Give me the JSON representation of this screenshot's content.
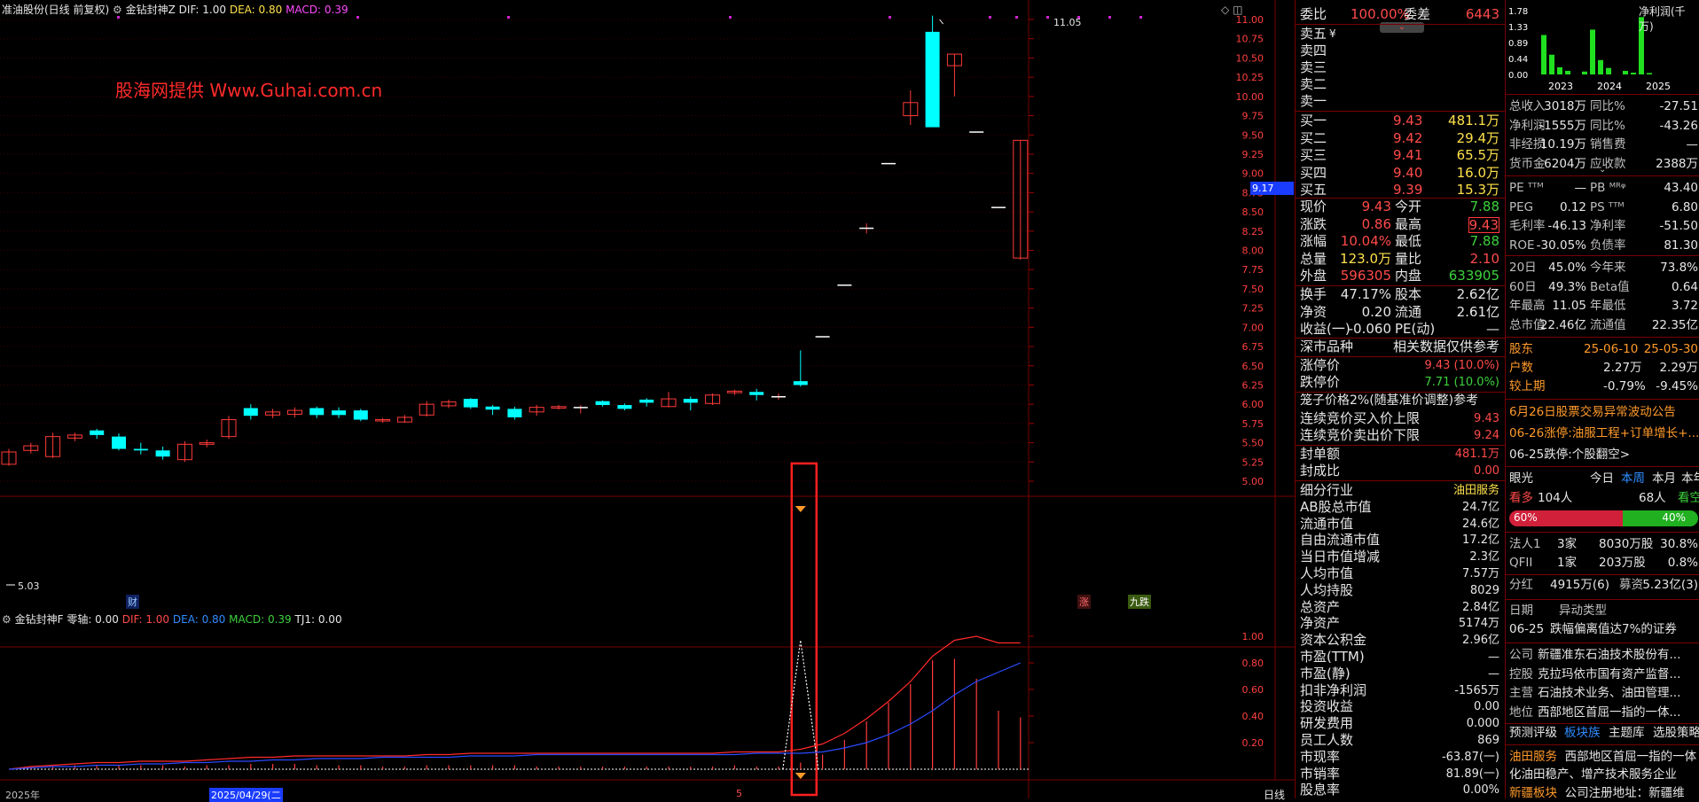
{
  "chart_header": {
    "stock_name": "准油股份(日线 前复权)",
    "indicator": "金钻封神Z",
    "dif": "DIF: 1.00",
    "dea": "DEA: 0.80",
    "macd": "MACD: 0.39"
  },
  "watermark": "股海网提供  Www.Guhai.com.cn",
  "price_axis": [
    "11.00",
    "10.75",
    "10.50",
    "10.25",
    "10.00",
    "9.75",
    "9.50",
    "9.25",
    "9.00",
    "8.75",
    "8.50",
    "8.25",
    "8.00",
    "7.75",
    "7.50",
    "7.25",
    "7.00",
    "6.75",
    "6.50",
    "6.25",
    "6.00",
    "5.75",
    "5.50",
    "5.25",
    "5.00"
  ],
  "price_tag": "9.17",
  "high_label": "11.05",
  "low_label": "5.03",
  "event_markers": {
    "cai": "财",
    "zhang": "涨",
    "jiudie": "九跌"
  },
  "sub_header": {
    "indicator": "金钻封神F",
    "zero": "零轴: 0.00",
    "dif": "DIF: 1.00",
    "dea": "DEA: 0.80",
    "macd": "MACD: 0.39",
    "tj1": "TJ1: 0.00"
  },
  "sub_axis": [
    "1.00",
    "0.80",
    "0.60",
    "0.40",
    "0.20"
  ],
  "date_axis": {
    "year": "2025年",
    "date": "2025/04/29(二",
    "mark": "5",
    "period": "日线"
  },
  "chart_data": {
    "type": "candlestick",
    "title": "准油股份(日线 前复权)",
    "ylim": [
      4.9,
      11.15
    ],
    "candles": [
      {
        "o": 5.22,
        "c": 5.38,
        "h": 5.42,
        "l": 5.2
      },
      {
        "o": 5.4,
        "c": 5.46,
        "h": 5.5,
        "l": 5.36
      },
      {
        "o": 5.32,
        "c": 5.58,
        "h": 5.63,
        "l": 5.3
      },
      {
        "o": 5.56,
        "c": 5.6,
        "h": 5.63,
        "l": 5.52
      },
      {
        "o": 5.66,
        "c": 5.6,
        "h": 5.68,
        "l": 5.55
      },
      {
        "o": 5.58,
        "c": 5.42,
        "h": 5.62,
        "l": 5.4
      },
      {
        "o": 5.42,
        "c": 5.4,
        "h": 5.5,
        "l": 5.35
      },
      {
        "o": 5.4,
        "c": 5.32,
        "h": 5.45,
        "l": 5.28
      },
      {
        "o": 5.28,
        "c": 5.48,
        "h": 5.52,
        "l": 5.25
      },
      {
        "o": 5.48,
        "c": 5.5,
        "h": 5.54,
        "l": 5.44
      },
      {
        "o": 5.58,
        "c": 5.8,
        "h": 5.85,
        "l": 5.55
      },
      {
        "o": 5.95,
        "c": 5.85,
        "h": 6.0,
        "l": 5.8
      },
      {
        "o": 5.86,
        "c": 5.9,
        "h": 5.94,
        "l": 5.82
      },
      {
        "o": 5.87,
        "c": 5.92,
        "h": 5.96,
        "l": 5.83
      },
      {
        "o": 5.95,
        "c": 5.86,
        "h": 5.97,
        "l": 5.82
      },
      {
        "o": 5.92,
        "c": 5.86,
        "h": 5.96,
        "l": 5.82
      },
      {
        "o": 5.92,
        "c": 5.8,
        "h": 5.94,
        "l": 5.78
      },
      {
        "o": 5.79,
        "c": 5.8,
        "h": 5.82,
        "l": 5.76
      },
      {
        "o": 5.77,
        "c": 5.83,
        "h": 5.86,
        "l": 5.76
      },
      {
        "o": 5.86,
        "c": 6.0,
        "h": 6.04,
        "l": 5.84
      },
      {
        "o": 5.98,
        "c": 6.03,
        "h": 6.06,
        "l": 5.95
      },
      {
        "o": 6.07,
        "c": 5.96,
        "h": 6.08,
        "l": 5.94
      },
      {
        "o": 5.97,
        "c": 5.93,
        "h": 5.99,
        "l": 5.86
      },
      {
        "o": 5.94,
        "c": 5.83,
        "h": 5.97,
        "l": 5.8
      },
      {
        "o": 5.9,
        "c": 5.96,
        "h": 5.99,
        "l": 5.85
      },
      {
        "o": 5.95,
        "c": 5.97,
        "h": 5.99,
        "l": 5.93
      },
      {
        "o": 5.96,
        "c": 5.96,
        "h": 5.99,
        "l": 5.88
      },
      {
        "o": 6.04,
        "c": 5.99,
        "h": 6.05,
        "l": 5.97
      },
      {
        "o": 5.99,
        "c": 5.94,
        "h": 6.01,
        "l": 5.92
      },
      {
        "o": 6.06,
        "c": 6.02,
        "h": 6.08,
        "l": 5.97
      },
      {
        "o": 5.97,
        "c": 6.07,
        "h": 6.16,
        "l": 5.96
      },
      {
        "o": 6.07,
        "c": 6.02,
        "h": 6.1,
        "l": 5.92
      },
      {
        "o": 6.01,
        "c": 6.12,
        "h": 6.14,
        "l": 5.99
      },
      {
        "o": 6.15,
        "c": 6.17,
        "h": 6.19,
        "l": 6.12
      },
      {
        "o": 6.16,
        "c": 6.12,
        "h": 6.2,
        "l": 6.05
      },
      {
        "o": 6.1,
        "c": 6.1,
        "h": 6.14,
        "l": 6.06
      },
      {
        "o": 6.3,
        "c": 6.25,
        "h": 6.7,
        "l": 6.23
      },
      {
        "o": 6.88,
        "c": 6.88,
        "h": 6.88,
        "l": 6.88
      },
      {
        "o": 7.55,
        "c": 7.55,
        "h": 7.55,
        "l": 7.55
      },
      {
        "o": 8.29,
        "c": 8.29,
        "h": 8.35,
        "l": 8.22
      },
      {
        "o": 9.13,
        "c": 9.13,
        "h": 9.13,
        "l": 9.13
      },
      {
        "o": 9.75,
        "c": 9.92,
        "h": 10.08,
        "l": 9.63
      },
      {
        "o": 10.84,
        "c": 9.6,
        "h": 11.05,
        "l": 9.6
      },
      {
        "o": 10.4,
        "c": 10.55,
        "h": 10.55,
        "l": 10.0
      },
      {
        "o": 9.54,
        "c": 9.54,
        "h": 9.54,
        "l": 9.54
      },
      {
        "o": 8.56,
        "c": 8.56,
        "h": 8.56,
        "l": 8.56
      },
      {
        "o": 7.9,
        "c": 9.43,
        "h": 9.43,
        "l": 7.88
      }
    ],
    "sub_series": [
      {
        "name": "DIF",
        "values": [
          0.0,
          0.02,
          0.03,
          0.04,
          0.05,
          0.05,
          0.06,
          0.06,
          0.06,
          0.07,
          0.08,
          0.09,
          0.09,
          0.1,
          0.1,
          0.1,
          0.1,
          0.1,
          0.1,
          0.11,
          0.11,
          0.12,
          0.12,
          0.12,
          0.12,
          0.12,
          0.12,
          0.12,
          0.12,
          0.12,
          0.12,
          0.12,
          0.12,
          0.13,
          0.13,
          0.13,
          0.15,
          0.19,
          0.27,
          0.38,
          0.51,
          0.66,
          0.85,
          0.97,
          1.0,
          0.95,
          0.95
        ]
      },
      {
        "name": "DEA",
        "values": [
          0.0,
          0.01,
          0.02,
          0.02,
          0.03,
          0.03,
          0.04,
          0.04,
          0.05,
          0.05,
          0.06,
          0.06,
          0.07,
          0.07,
          0.08,
          0.08,
          0.08,
          0.09,
          0.09,
          0.09,
          0.09,
          0.1,
          0.1,
          0.1,
          0.11,
          0.11,
          0.11,
          0.11,
          0.11,
          0.11,
          0.11,
          0.11,
          0.11,
          0.11,
          0.12,
          0.12,
          0.12,
          0.13,
          0.16,
          0.2,
          0.26,
          0.34,
          0.44,
          0.56,
          0.66,
          0.73,
          0.8
        ]
      },
      {
        "name": "MACD",
        "values": [
          0,
          0.02,
          0.02,
          0.03,
          0.03,
          0.03,
          0.03,
          0.03,
          0.02,
          0.03,
          0.03,
          0.04,
          0.04,
          0.04,
          0.03,
          0.03,
          0.03,
          0.02,
          0.02,
          0.03,
          0.03,
          0.03,
          0.03,
          0.03,
          0.02,
          0.02,
          0.02,
          0.02,
          0.02,
          0.02,
          0.02,
          0.02,
          0.02,
          0.03,
          0.02,
          0.02,
          0.05,
          0.11,
          0.22,
          0.36,
          0.5,
          0.64,
          0.82,
          0.83,
          0.68,
          0.44,
          0.39
        ]
      }
    ]
  },
  "quote": {
    "weibi_label": "委比",
    "weibi_value": "100.00%",
    "weicha_label": "委差",
    "weicha_value": "6443",
    "sell": [
      {
        "label": "卖五",
        "mark": "¥"
      },
      {
        "label": "卖四"
      },
      {
        "label": "卖三"
      },
      {
        "label": "卖二"
      },
      {
        "label": "卖一"
      }
    ],
    "buy": [
      {
        "label": "买一",
        "price": "9.43",
        "vol": "481.1万"
      },
      {
        "label": "买二",
        "price": "9.42",
        "vol": "29.4万"
      },
      {
        "label": "买三",
        "price": "9.41",
        "vol": "65.5万"
      },
      {
        "label": "买四",
        "price": "9.40",
        "vol": "16.0万"
      },
      {
        "label": "买五",
        "price": "9.39",
        "vol": "15.3万"
      }
    ],
    "stats": [
      {
        "l1": "现价",
        "v1": "9.43",
        "l2": "今开",
        "v2": "7.88"
      },
      {
        "l1": "涨跌",
        "v1": "0.86",
        "l2": "最高",
        "v2": "9.43"
      },
      {
        "l1": "涨幅",
        "v1": "10.04%",
        "l2": "最低",
        "v2": "7.88"
      },
      {
        "l1": "总量",
        "v1": "123.0万",
        "l2": "量比",
        "v2": "2.10"
      },
      {
        "l1": "外盘",
        "v1": "596305",
        "l2": "内盘",
        "v2": "633905"
      }
    ],
    "stats2": [
      {
        "l1": "换手",
        "v1": "47.17%",
        "l2": "股本",
        "v2": "2.62亿"
      },
      {
        "l1": "净资",
        "v1": "0.20",
        "l2": "流通",
        "v2": "2.61亿"
      },
      {
        "l1": "收益(一)",
        "v1": "-0.060",
        "l2": "PE(动)",
        "v2": "—"
      }
    ],
    "market": "深市品种",
    "market_note": "相关数据仅供参考",
    "limit_up_label": "涨停价",
    "limit_up": "9.43 (10.0%)",
    "limit_down_label": "跌停价",
    "limit_down": "7.71 (10.0%)",
    "cage_note": "笼子价格2%(随基准价调整)参考",
    "cage_buy_label": "连续竞价买入价上限",
    "cage_buy": "9.43",
    "cage_sell_label": "连续竞价卖出价下限",
    "cage_sell": "9.24",
    "seal_label": "封单额",
    "seal": "481.1万",
    "seal_ratio_label": "封成比",
    "seal_ratio": "0.00",
    "fund": [
      {
        "l": "细分行业",
        "v": "油田服务"
      },
      {
        "l": "AB股总市值",
        "v": "24.7亿"
      },
      {
        "l": "流通市值",
        "v": "24.6亿"
      },
      {
        "l": "自由流通市值",
        "v": "17.2亿"
      },
      {
        "l": "当日市值增减",
        "v": "2.3亿"
      },
      {
        "l": "人均市值",
        "v": "7.57万"
      },
      {
        "l": "人均持股",
        "v": "8029"
      },
      {
        "l": "总资产",
        "v": "2.84亿"
      },
      {
        "l": "净资产",
        "v": "5174万"
      },
      {
        "l": "资本公积金",
        "v": "2.96亿"
      },
      {
        "l": "市盈(TTM)",
        "v": "—"
      },
      {
        "l": "市盈(静)",
        "v": "—"
      },
      {
        "l": "扣非净利润",
        "v": "-1565万"
      },
      {
        "l": "投资收益",
        "v": "0.00"
      },
      {
        "l": "研发费用",
        "v": "0.000"
      },
      {
        "l": "员工人数",
        "v": "869"
      },
      {
        "l": "市现率",
        "v": "-63.87(一)"
      },
      {
        "l": "市销率",
        "v": "81.89(一)"
      },
      {
        "l": "股息率",
        "v": "0.00%"
      }
    ]
  },
  "finance": {
    "mini_chart": {
      "title": "净利润(千万)",
      "yticks": [
        "1.78",
        "1.33",
        "0.89",
        "0.44",
        "0.00"
      ],
      "years": [
        "2023",
        "2024",
        "2025"
      ],
      "values": [
        1.1,
        0.55,
        0.2,
        0.1,
        0.08,
        1.25,
        0.4,
        0.18,
        0.1,
        0.05,
        1.6,
        0.04
      ]
    },
    "rows": [
      {
        "l1": "总收入",
        "v1": "3018万",
        "l2": "同比%",
        "v2": "-27.51"
      },
      {
        "l1": "净利润",
        "v1": "-1555万",
        "l2": "同比%",
        "v2": "-43.26"
      },
      {
        "l1": "非经损",
        "v1": "10.19万",
        "l2": "销售费",
        "v2": "—"
      },
      {
        "l1": "货币金",
        "v1": "6204万",
        "l2": "应收款",
        "v2": "2388万"
      }
    ],
    "ratios": [
      {
        "l1": "PE ᵀᵀᴹ",
        "v1": "—",
        "l2": "PB ᴹᴿᵠ",
        "v2": "43.40"
      },
      {
        "l1": "PEG",
        "v1": "0.12",
        "l2": "PS ᵀᵀᴹ",
        "v2": "6.80"
      },
      {
        "l1": "毛利率",
        "v1": "-46.13",
        "l2": "净利率",
        "v2": "-51.50"
      },
      {
        "l1": "ROE",
        "v1": "-30.05%",
        "l2": "负债率",
        "v2": "81.30"
      }
    ],
    "perf": [
      {
        "l1": "20日",
        "v1": "45.0%",
        "l2": "今年来",
        "v2": "73.8%"
      },
      {
        "l1": "60日",
        "v1": "49.3%",
        "l2": "Beta值",
        "v2": "0.64"
      },
      {
        "l1": "年最高",
        "v1": "11.05",
        "l2": "年最低",
        "v2": "3.72"
      },
      {
        "l1": "总市值",
        "v1": "22.46亿",
        "l2": "流通值",
        "v2": "22.35亿"
      }
    ],
    "holders": {
      "label": "股东",
      "d1": "25-06-10",
      "d2": "25-05-30",
      "rows": [
        {
          "l": "户数",
          "v1": "2.27万",
          "v2": "2.29万"
        },
        {
          "l": "较上期",
          "v1": "-0.79%",
          "v2": "-9.45%"
        }
      ]
    },
    "news": [
      "6月26日股票交易异常波动公告",
      "06-26涨停:油服工程+订单增长+...",
      "06-25跌停:个股翻空>"
    ],
    "vision": {
      "label": "眼光",
      "tabs": [
        "今日",
        "本周",
        "本月",
        "本年"
      ],
      "bull_label": "看多",
      "bull_count": "104人",
      "bear_count": "68人",
      "bear_label": "看空",
      "bull_pct": "60%",
      "bear_pct": "40%"
    },
    "inst": [
      {
        "l": "法人1",
        "v1": "3家",
        "v2": "8030万股",
        "v3": "30.8%"
      },
      {
        "l": "QFII",
        "v1": "1家",
        "v2": "203万股",
        "v3": "0.8%"
      }
    ],
    "dividend": {
      "l": "分红",
      "v1": "4915万(6)",
      "l2": "募资",
      "v2": "5.23亿(3)"
    },
    "abnormal": {
      "h1": "日期",
      "h2": "异动类型",
      "date": "06-25",
      "type": "跌幅偏离值达7%的证券"
    },
    "company": [
      {
        "l": "公司",
        "v": "新疆准东石油技术股份有..."
      },
      {
        "l": "控股",
        "v": "克拉玛依市国有资产监督..."
      },
      {
        "l": "主营",
        "v": "石油技术业务、油田管理..."
      },
      {
        "l": "地位",
        "v": "西部地区首屈一指的一体..."
      }
    ],
    "bottom_tabs": [
      "预测评级",
      "板块族",
      "主题库",
      "选股策略"
    ],
    "sector_label": "油田服务",
    "sector_text": "西部地区首屈一指的一体化油田稳产、增产技术服务企业",
    "region_label": "新疆板块",
    "region_text": "公司注册地址：新疆维"
  },
  "colors": {
    "up": "#ff3a3a",
    "down": "#00ffff",
    "accent": "#ff0000"
  }
}
